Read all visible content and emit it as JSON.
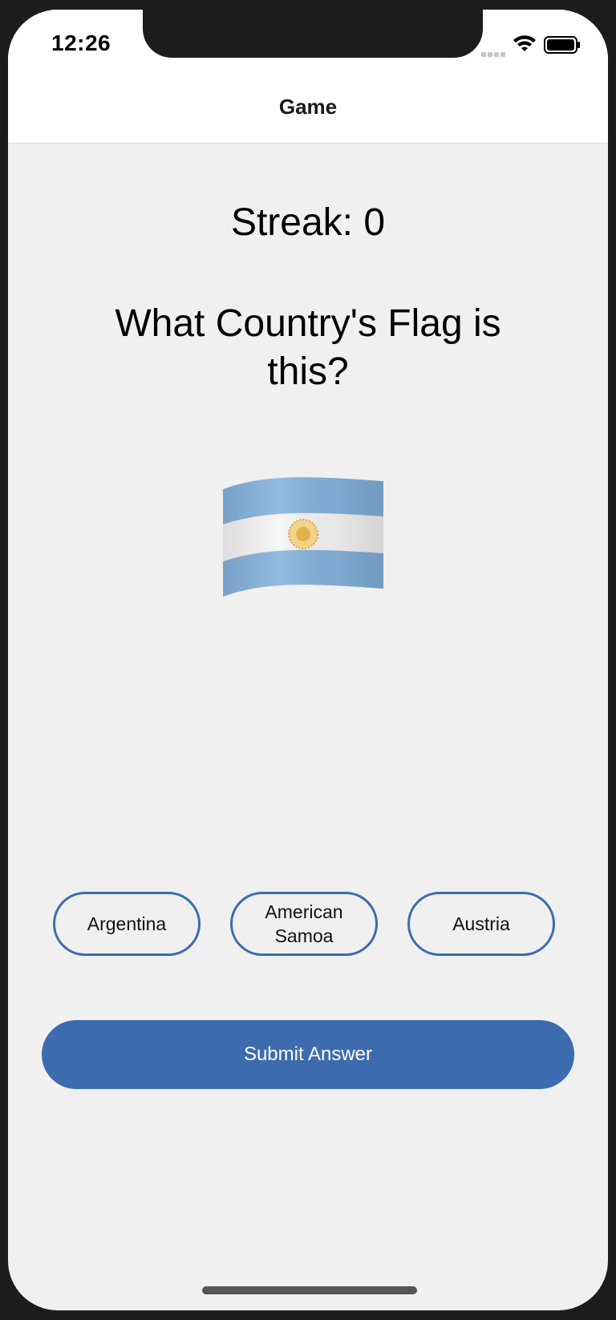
{
  "status_bar": {
    "time": "12:26"
  },
  "nav": {
    "title": "Game"
  },
  "game": {
    "streak_label": "Streak: 0",
    "question": "What Country's Flag is this?",
    "flag_icon": "argentina-flag-icon",
    "choices": [
      {
        "label": "Argentina"
      },
      {
        "label": "American Samoa"
      },
      {
        "label": "Austria"
      }
    ],
    "submit_label": "Submit Answer"
  },
  "colors": {
    "accent": "#3c6caf",
    "background": "#f0f0f0",
    "nav_background": "#ffffff",
    "flag_blue": "#86b3de",
    "flag_sun": "#e0b34a"
  }
}
